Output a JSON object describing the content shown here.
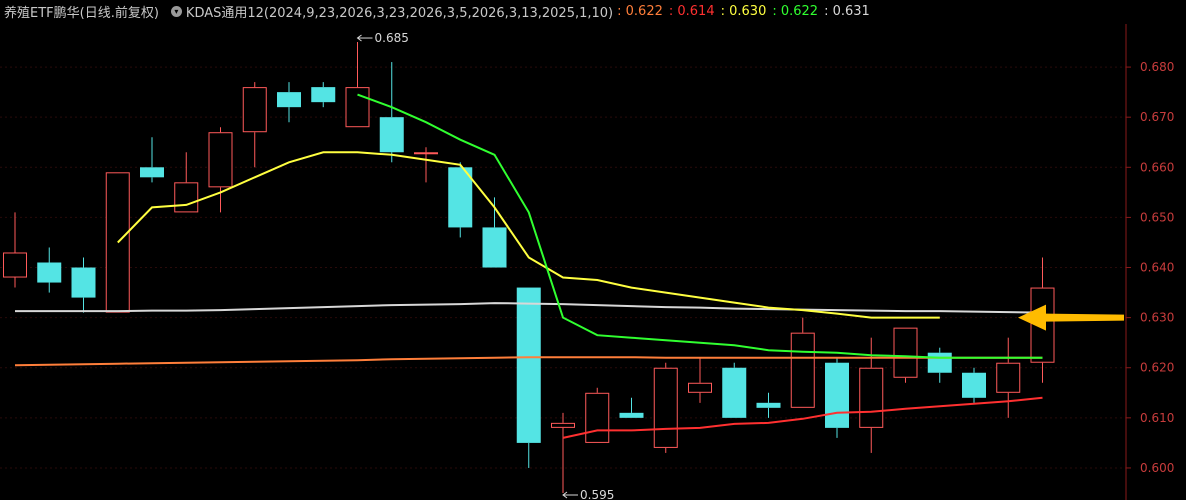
{
  "header": {
    "title": "养殖ETF鹏华(日线.前复权)",
    "indicator": "KDAS通用12(2024,9,23,2026,3,23,2026,3,5,2026,3,13,2025,1,10)",
    "values": [
      {
        "text": ": 0.622",
        "color": "#ff7e3a"
      },
      {
        "text": ": 0.614",
        "color": "#ff3030"
      },
      {
        "text": ": 0.630",
        "color": "#ffff40"
      },
      {
        "text": ": 0.622",
        "color": "#30ff30"
      },
      {
        "text": ": 0.631",
        "color": "#d8d8d8"
      }
    ]
  },
  "chart_data": {
    "type": "candlestick",
    "ylim": [
      0.596,
      0.687
    ],
    "y_ticks": [
      "0.680",
      "0.670",
      "0.660",
      "0.650",
      "0.640",
      "0.630",
      "0.620",
      "0.610",
      "0.600"
    ],
    "candles": [
      {
        "o": 0.638,
        "h": 0.651,
        "l": 0.636,
        "c": 0.643
      },
      {
        "o": 0.641,
        "h": 0.644,
        "l": 0.635,
        "c": 0.637
      },
      {
        "o": 0.64,
        "h": 0.642,
        "l": 0.631,
        "c": 0.634
      },
      {
        "o": 0.631,
        "h": 0.659,
        "l": 0.631,
        "c": 0.659
      },
      {
        "o": 0.66,
        "h": 0.666,
        "l": 0.657,
        "c": 0.658
      },
      {
        "o": 0.651,
        "h": 0.663,
        "l": 0.651,
        "c": 0.657
      },
      {
        "o": 0.656,
        "h": 0.668,
        "l": 0.651,
        "c": 0.667
      },
      {
        "o": 0.667,
        "h": 0.677,
        "l": 0.66,
        "c": 0.676
      },
      {
        "o": 0.675,
        "h": 0.677,
        "l": 0.669,
        "c": 0.672
      },
      {
        "o": 0.676,
        "h": 0.677,
        "l": 0.672,
        "c": 0.673
      },
      {
        "o": 0.668,
        "h": 0.685,
        "l": 0.668,
        "c": 0.676
      },
      {
        "o": 0.67,
        "h": 0.681,
        "l": 0.661,
        "c": 0.663
      },
      {
        "o": 0.663,
        "h": 0.664,
        "l": 0.657,
        "c": 0.663
      },
      {
        "o": 0.66,
        "h": 0.661,
        "l": 0.646,
        "c": 0.648
      },
      {
        "o": 0.648,
        "h": 0.654,
        "l": 0.64,
        "c": 0.64
      },
      {
        "o": 0.636,
        "h": 0.636,
        "l": 0.6,
        "c": 0.605
      },
      {
        "o": 0.608,
        "h": 0.611,
        "l": 0.595,
        "c": 0.609
      },
      {
        "o": 0.605,
        "h": 0.616,
        "l": 0.605,
        "c": 0.615
      },
      {
        "o": 0.611,
        "h": 0.614,
        "l": 0.61,
        "c": 0.61
      },
      {
        "o": 0.604,
        "h": 0.621,
        "l": 0.603,
        "c": 0.62
      },
      {
        "o": 0.615,
        "h": 0.622,
        "l": 0.613,
        "c": 0.617
      },
      {
        "o": 0.62,
        "h": 0.621,
        "l": 0.61,
        "c": 0.61
      },
      {
        "o": 0.613,
        "h": 0.615,
        "l": 0.61,
        "c": 0.612
      },
      {
        "o": 0.612,
        "h": 0.63,
        "l": 0.612,
        "c": 0.627
      },
      {
        "o": 0.621,
        "h": 0.622,
        "l": 0.606,
        "c": 0.608
      },
      {
        "o": 0.608,
        "h": 0.626,
        "l": 0.603,
        "c": 0.62
      },
      {
        "o": 0.618,
        "h": 0.628,
        "l": 0.617,
        "c": 0.628
      },
      {
        "o": 0.623,
        "h": 0.624,
        "l": 0.617,
        "c": 0.619
      },
      {
        "o": 0.619,
        "h": 0.62,
        "l": 0.613,
        "c": 0.614
      },
      {
        "o": 0.615,
        "h": 0.626,
        "l": 0.61,
        "c": 0.621
      },
      {
        "o": 0.621,
        "h": 0.642,
        "l": 0.617,
        "c": 0.636
      }
    ],
    "series": [
      {
        "color": "#ff7e3a",
        "values": [
          0.6205,
          0.6206,
          0.6207,
          0.6208,
          0.6209,
          0.621,
          0.6211,
          0.6212,
          0.6213,
          0.6214,
          0.6215,
          0.6217,
          0.6218,
          0.6219,
          0.622,
          0.6221,
          0.6221,
          0.6221,
          0.6221,
          0.622,
          0.622,
          0.622,
          0.622,
          0.622,
          0.622,
          0.622,
          0.622,
          0.622,
          0.622,
          0.622,
          0.622
        ]
      },
      {
        "color": "#d8d8d8",
        "values": [
          0.6313,
          0.6313,
          0.6313,
          0.6313,
          0.6314,
          0.6314,
          0.6315,
          0.6317,
          0.6319,
          0.6321,
          0.6323,
          0.6325,
          0.6326,
          0.6327,
          0.6329,
          0.6328,
          0.6327,
          0.6325,
          0.6323,
          0.6321,
          0.632,
          0.6318,
          0.6317,
          0.6316,
          0.6315,
          0.6314,
          0.6313,
          0.6313,
          0.6312,
          0.6311,
          0.631
        ]
      },
      {
        "color": "#ffff40",
        "start": 3,
        "values": [
          0.645,
          0.652,
          0.6525,
          0.655,
          0.658,
          0.661,
          0.663,
          0.663,
          0.6625,
          0.6615,
          0.6605,
          0.652,
          0.642,
          0.638,
          0.6375,
          0.636,
          0.635,
          0.634,
          0.633,
          0.632,
          0.6315,
          0.6308,
          0.63,
          0.63,
          0.63
        ]
      },
      {
        "color": "#30ff30",
        "start": 10,
        "values": [
          0.6745,
          0.672,
          0.669,
          0.6655,
          0.6625,
          0.651,
          0.63,
          0.6265,
          0.626,
          0.6255,
          0.625,
          0.6245,
          0.6235,
          0.6232,
          0.623,
          0.6225,
          0.6223,
          0.622,
          0.622,
          0.622,
          0.622
        ]
      },
      {
        "color": "#ff3030",
        "start": 16,
        "values": [
          0.606,
          0.6075,
          0.6075,
          0.6078,
          0.608,
          0.6088,
          0.609,
          0.6098,
          0.611,
          0.6112,
          0.6118,
          0.6123,
          0.6128,
          0.6133,
          0.614
        ]
      }
    ],
    "annotations": [
      {
        "text": "0.685",
        "index": 10,
        "value": 0.685,
        "side": "high"
      },
      {
        "text": "0.595",
        "index": 16,
        "value": 0.595,
        "side": "low"
      }
    ],
    "arrow": {
      "color": "#ffbb00",
      "value": 0.63
    }
  }
}
